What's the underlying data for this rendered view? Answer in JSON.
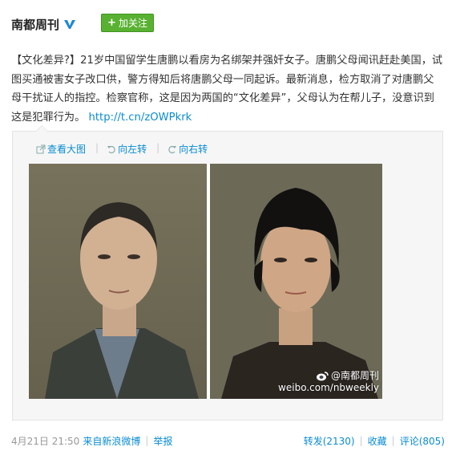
{
  "header": {
    "account_name": "南都周刊",
    "follow_label": "加关注"
  },
  "post": {
    "tag": "【文化差异?】",
    "text": "21岁中国留学生唐鹏以看房为名绑架并强奸女子。唐鹏父母闻讯赶赴美国，试图买通被害女子改口供，警方得知后将唐鹏父母一同起诉。最新消息，检方取消了对唐鹏父母干扰证人的指控。检察官称，这是因为两国的“文化差异”，父母认为在帮儿子，没意识到这是犯罪行为。",
    "link": "http://t.cn/zOWPkrk"
  },
  "media": {
    "view_large_label": "查看大图",
    "rotate_left_label": "向左转",
    "rotate_right_label": "向右转",
    "watermark_handle": "@南都周刊",
    "watermark_url": "weibo.com/nbweekly"
  },
  "footer": {
    "timestamp": "4月21日 21:50",
    "source": "来自新浪微博",
    "report_label": "举报",
    "repost_label": "转发(2130)",
    "favorite_label": "收藏",
    "comment_label": "评论(805)"
  },
  "colors": {
    "link": "#0a8cd2",
    "follow_green": "#59b132",
    "verified_blue": "#1f87d6"
  }
}
